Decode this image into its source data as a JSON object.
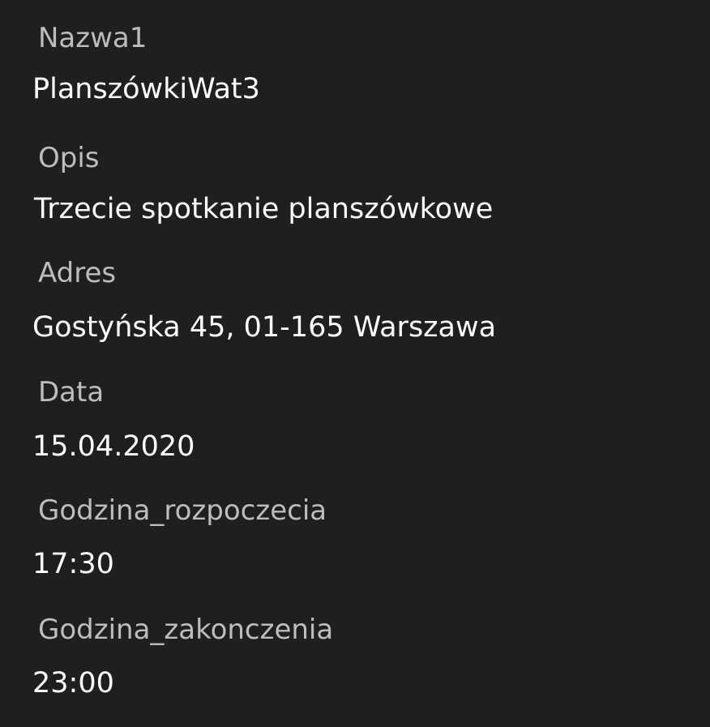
{
  "event": {
    "fields": [
      {
        "label": "Nazwa1",
        "value": "PlanszówkiWat3"
      },
      {
        "label": "Opis",
        "value": "Trzecie spotkanie planszówkowe"
      },
      {
        "label": "Adres",
        "value": "Gostyńska 45, 01-165 Warszawa"
      },
      {
        "label": "Data",
        "value": "15.04.2020"
      },
      {
        "label": "Godzina_rozpoczecia",
        "value": "17:30"
      },
      {
        "label": "Godzina_zakonczenia",
        "value": "23:00"
      }
    ]
  },
  "colors": {
    "background": "#1f1f1f",
    "label": "#bdbdbd",
    "value": "#ffffff"
  }
}
